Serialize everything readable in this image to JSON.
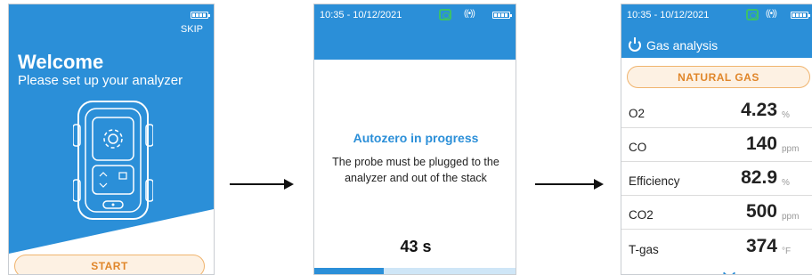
{
  "screen1": {
    "skip_label": "SKIP",
    "title": "Welcome",
    "subtitle": "Please set up your analyzer",
    "start_label": "START"
  },
  "screen2": {
    "time": "10:35 - 10/12/2021",
    "heading": "Autozero in progress",
    "message": "The probe must be plugged to the analyzer and out of the stack",
    "countdown": "43 s",
    "progress_fraction": 0.34
  },
  "screen3": {
    "time": "10:35 - 10/12/2021",
    "title": "Gas analysis",
    "gas_type": "NATURAL GAS",
    "measurements": [
      {
        "name": "O2",
        "value": "4.23",
        "unit": "%"
      },
      {
        "name": "CO",
        "value": "140",
        "unit": "ppm"
      },
      {
        "name": "Efficiency",
        "value": "82.9",
        "unit": "%"
      },
      {
        "name": "CO2",
        "value": "500",
        "unit": "ppm"
      },
      {
        "name": "T-gas",
        "value": "374",
        "unit": "°F"
      }
    ]
  },
  "colors": {
    "primary_blue": "#2b8fd8",
    "accent_orange": "#e0862a",
    "status_green": "#3cc06a"
  },
  "icons": [
    "battery-icon",
    "gear-icon",
    "cloud-sync-icon",
    "radio-signal-icon",
    "power-icon",
    "chevron-down-icon",
    "arrow-right-icon"
  ]
}
